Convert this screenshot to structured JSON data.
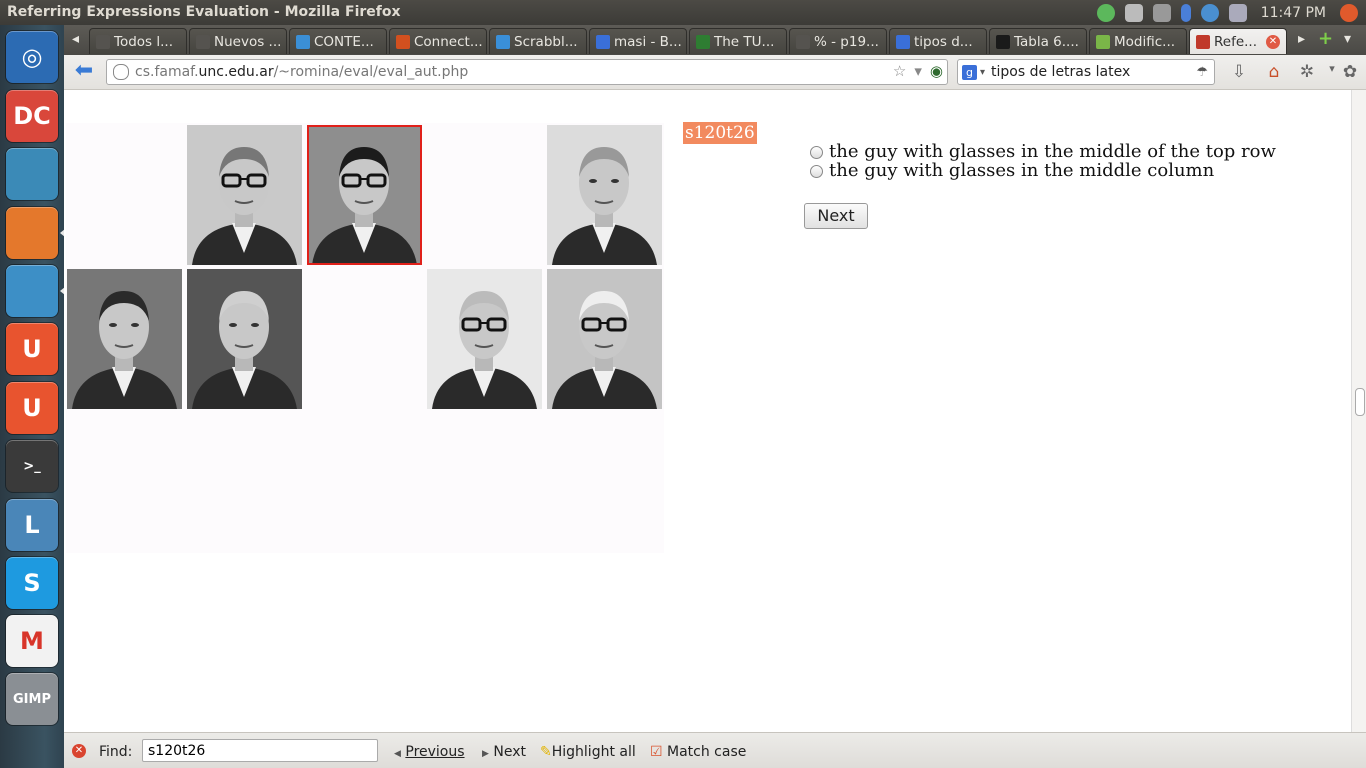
{
  "window": {
    "title": "Referring Expressions Evaluation - Mozilla Firefox"
  },
  "tray": {
    "clock": "11:47 PM"
  },
  "launcher": {
    "items": [
      {
        "name": "ubuntu-dash-icon",
        "color": "#2c6bb3",
        "glyph": "◎"
      },
      {
        "name": "clipgrab-icon",
        "color": "#d9473b",
        "glyph": "DC"
      },
      {
        "name": "files-icon",
        "color": "#3b8ab7",
        "glyph": ""
      },
      {
        "name": "firefox-icon",
        "color": "#e4782c",
        "glyph": ""
      },
      {
        "name": "writer-icon",
        "color": "#3d8fc6",
        "glyph": ""
      },
      {
        "name": "ubuntu-one-icon",
        "color": "#e8542f",
        "glyph": "U"
      },
      {
        "name": "ubuntu-one-music-icon",
        "color": "#e8542f",
        "glyph": "U"
      },
      {
        "name": "terminal-icon",
        "color": "#3a3a3a",
        "glyph": ">_"
      },
      {
        "name": "lyx-icon",
        "color": "#4a86b8",
        "glyph": "L"
      },
      {
        "name": "skype-icon",
        "color": "#1e9ae0",
        "glyph": "S"
      },
      {
        "name": "gmail-icon",
        "color": "#f2f2f2",
        "glyph": "M"
      },
      {
        "name": "gimp-icon",
        "color": "#8a8f94",
        "glyph": "GIMP"
      }
    ]
  },
  "tabs": [
    {
      "label": "Todos l...",
      "color": "#55534f"
    },
    {
      "label": "Nuevos ...",
      "color": "#55534f"
    },
    {
      "label": "CONTE...",
      "color": "#3b8fd6"
    },
    {
      "label": "Connect...",
      "color": "#d2501f"
    },
    {
      "label": "Scrabbl...",
      "color": "#3a8fd8"
    },
    {
      "label": "masi - B...",
      "color": "#3a6fd8"
    },
    {
      "label": "The TU...",
      "color": "#2e7d32"
    },
    {
      "label": "% - p19...",
      "color": "#55534f"
    },
    {
      "label": "tipos d...",
      "color": "#3a6fd8"
    },
    {
      "label": "Tabla 6....",
      "color": "#1a1a1a"
    },
    {
      "label": "Modific...",
      "color": "#7ab648"
    },
    {
      "label": "Refe...",
      "color": "#c0392b"
    }
  ],
  "navbar": {
    "url_host_prefix": "cs.famaf.",
    "url_host": "unc.edu.ar",
    "url_path": "/~romina/eval/eval_aut.php",
    "search_text": "tipos de letras latex"
  },
  "page": {
    "trial_id": "s120t26",
    "options": [
      "the guy with glasses in the middle of the top row",
      "the guy with glasses in the middle column"
    ],
    "next_label": "Next"
  },
  "findbar": {
    "label": "Find:",
    "value": "s120t26",
    "previous_label": "Previous",
    "next_label": "Next",
    "highlight_label": "Highlight all",
    "match_case_label": "Match case"
  }
}
